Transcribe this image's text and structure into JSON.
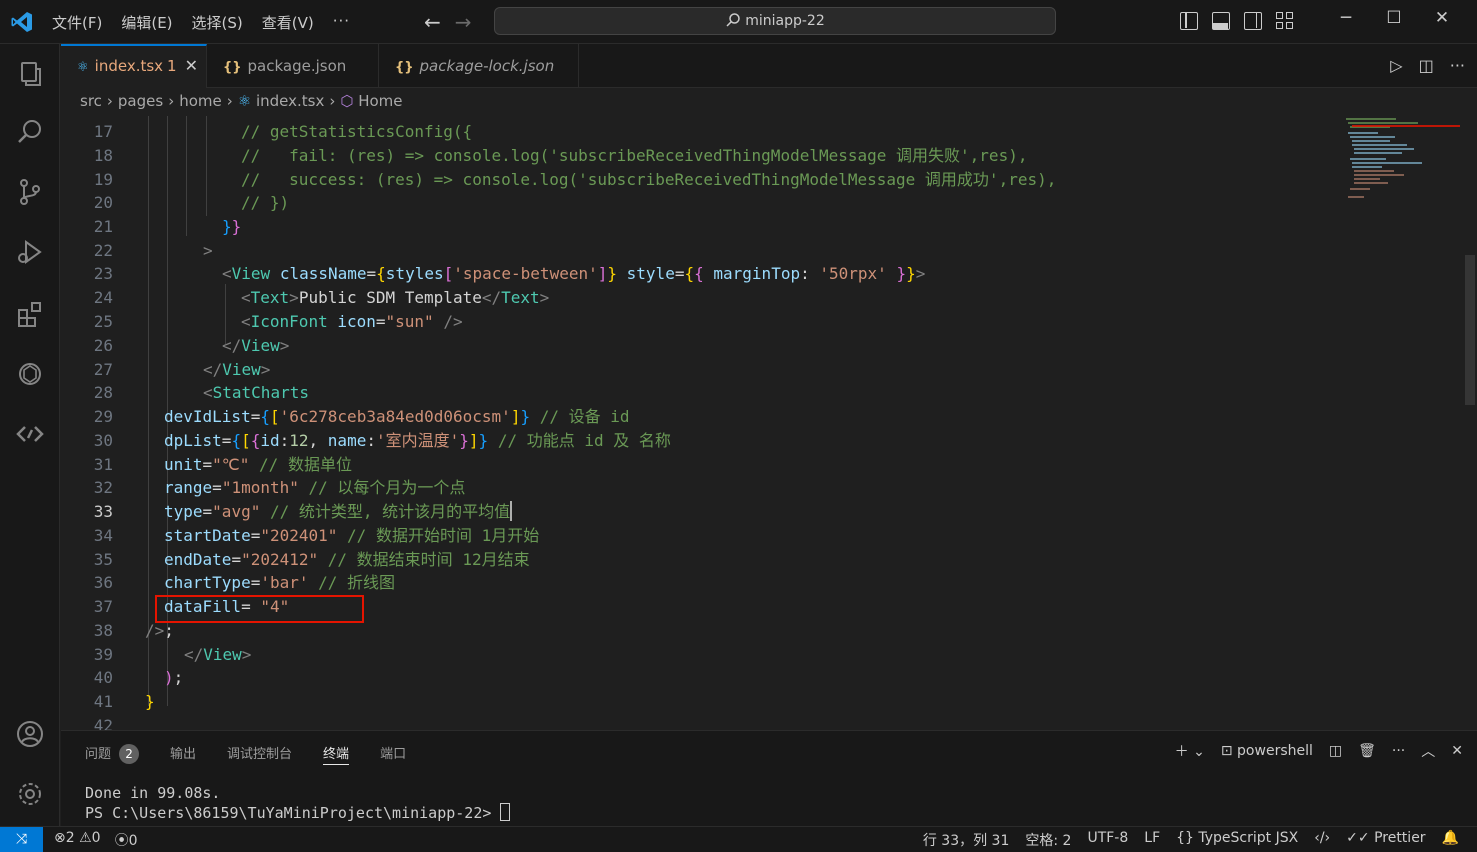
{
  "window": {
    "menu": [
      "文件(F)",
      "编辑(E)",
      "选择(S)",
      "查看(V)",
      "···"
    ],
    "search_text": "miniapp-22",
    "controls": [
      "─",
      "☐",
      "✕"
    ]
  },
  "tabs": [
    {
      "label": "index.tsx",
      "badge": "1",
      "icon": "react-icon",
      "close": "✕"
    },
    {
      "label": "package.json",
      "icon": "json-braces-icon"
    },
    {
      "label": "package-lock.json",
      "icon": "json-braces-icon"
    }
  ],
  "breadcrumb": [
    "src",
    "pages",
    "home",
    "index.tsx",
    "Home"
  ],
  "editor": {
    "current_line": "33",
    "lines": [
      {
        "n": "17"
      },
      {
        "n": "18"
      },
      {
        "n": "19"
      },
      {
        "n": "20"
      },
      {
        "n": "21"
      },
      {
        "n": "22"
      },
      {
        "n": "23"
      },
      {
        "n": "24"
      },
      {
        "n": "25"
      },
      {
        "n": "26"
      },
      {
        "n": "27"
      },
      {
        "n": "28"
      },
      {
        "n": "29"
      },
      {
        "n": "30"
      },
      {
        "n": "31"
      },
      {
        "n": "32"
      },
      {
        "n": "33"
      },
      {
        "n": "34"
      },
      {
        "n": "35"
      },
      {
        "n": "36"
      },
      {
        "n": "37"
      },
      {
        "n": "38"
      },
      {
        "n": "39"
      },
      {
        "n": "40"
      },
      {
        "n": "41"
      },
      {
        "n": "42"
      }
    ],
    "text": {
      "l17": "// getStatisticsConfig({",
      "l18": "//   fail: (res) => console.log('subscribeReceivedThingModelMessage 调用失败',res),",
      "l19": "//   success: (res) => console.log('subscribeReceivedThingModelMessage 调用成功',res),",
      "l20": "// })",
      "l29_attr": "devIdList",
      "l29_str": "'6c278ceb3a84ed0d06ocsm'",
      "l29_cmt": "// 设备 id",
      "l30_attr": "dpList",
      "l30_key1": "id",
      "l30_num": "12",
      "l30_key2": "name",
      "l30_str": "'室内温度'",
      "l30_cmt": "// 功能点 id 及 名称",
      "l31_attr": "unit",
      "l31_str": "\"℃\"",
      "l31_cmt": "// 数据单位",
      "l32_attr": "range",
      "l32_str": "\"1month\"",
      "l32_cmt": "// 以每个月为一个点",
      "l33_attr": "type",
      "l33_str": "\"avg\"",
      "l33_cmt": "// 统计类型, 统计该月的平均值",
      "l34_attr": "startDate",
      "l34_str": "\"202401\"",
      "l34_cmt": "// 数据开始时间 1月开始",
      "l35_attr": "endDate",
      "l35_str": "\"202412\"",
      "l35_cmt": "// 数据结束时间 12月结束",
      "l36_attr": "chartType",
      "l36_str": "'bar'",
      "l36_cmt": "// 折线图",
      "l37_attr": "dataFill",
      "l37_str": "\"4\"",
      "l23_cls": "className",
      "l23_styles": "styles",
      "l23_str": "'space-between'",
      "l23_style": "style",
      "l23_mt": "marginTop",
      "l23_val": "'50rpx'",
      "l24_text": "Public SDM Template",
      "l25_icon": "icon",
      "l25_val": "\"sun\""
    }
  },
  "panel": {
    "tabs": [
      "问题",
      "输出",
      "调试控制台",
      "终端",
      "端口"
    ],
    "problems_count": "2",
    "active_tab": "终端",
    "shell": "powershell",
    "terminal_lines": [
      "Done in 99.08s.",
      "PS C:\\Users\\86159\\TuYaMiniProject\\miniapp-22> "
    ]
  },
  "statusbar": {
    "errors": "2",
    "warnings": "0",
    "ports": "0",
    "position": "行 33，列 31",
    "spaces": "空格: 2",
    "encoding": "UTF-8",
    "eol": "LF",
    "language": "TypeScript JSX",
    "formatter": "Prettier"
  },
  "colors": {
    "accent": "#0078d4",
    "highlight_box": "#e51400"
  }
}
